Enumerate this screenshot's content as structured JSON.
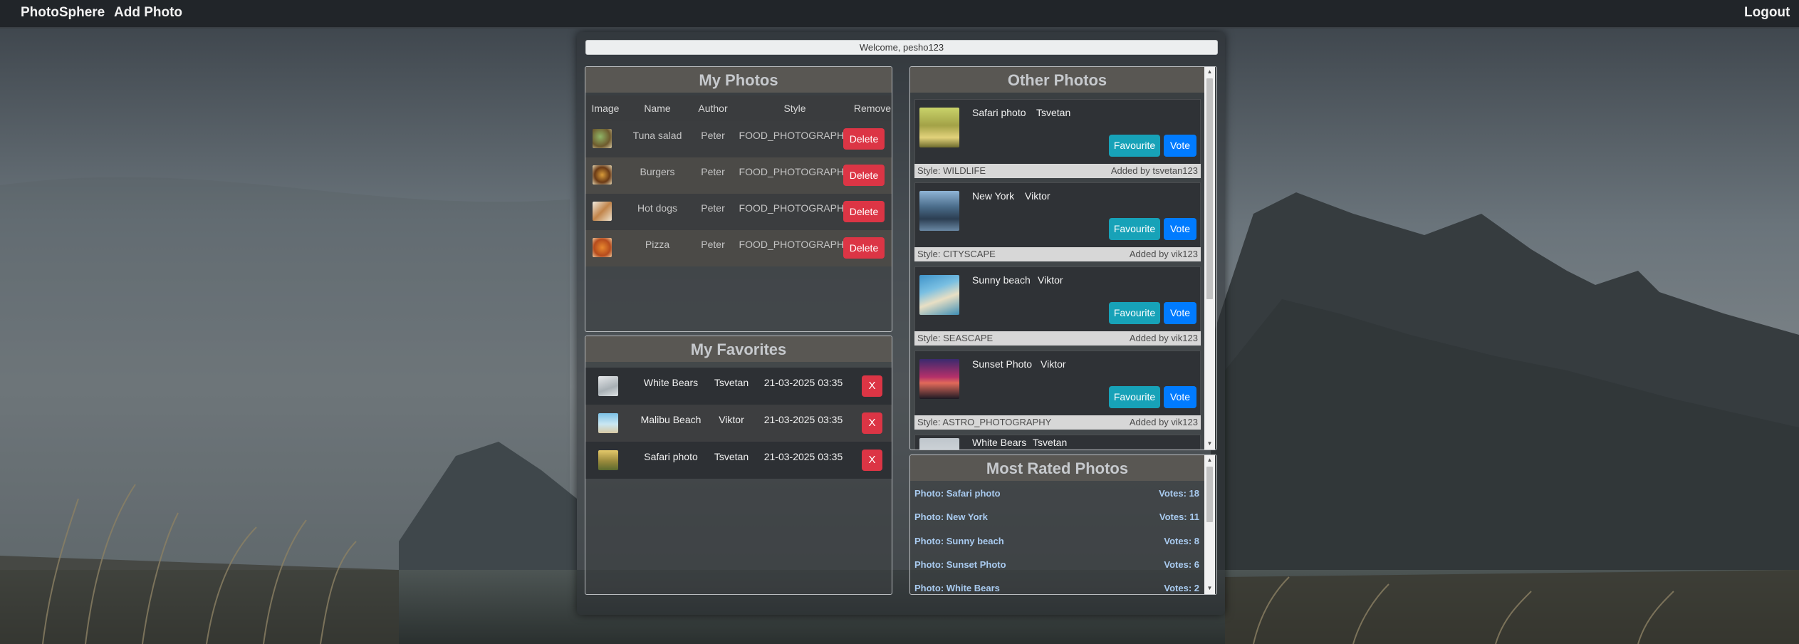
{
  "nav": {
    "brand": "PhotoSphere",
    "add_photo": "Add Photo",
    "logout": "Logout"
  },
  "welcome": "Welcome, pesho123",
  "my_photos": {
    "title": "My Photos",
    "columns": [
      "Image",
      "Name",
      "Author",
      "Style",
      "Remove"
    ],
    "rows": [
      {
        "name": "Tuna salad",
        "author": "Peter",
        "style": "FOOD_PHOTOGRAPHY",
        "action": "Delete"
      },
      {
        "name": "Burgers",
        "author": "Peter",
        "style": "FOOD_PHOTOGRAPHY",
        "action": "Delete"
      },
      {
        "name": "Hot dogs",
        "author": "Peter",
        "style": "FOOD_PHOTOGRAPHY",
        "action": "Delete"
      },
      {
        "name": "Pizza",
        "author": "Peter",
        "style": "FOOD_PHOTOGRAPHY",
        "action": "Delete"
      }
    ]
  },
  "my_favorites": {
    "title": "My Favorites",
    "rows": [
      {
        "name": "White Bears",
        "author": "Tsvetan",
        "date": "21-03-2025 03:35",
        "action": "X"
      },
      {
        "name": "Malibu Beach",
        "author": "Viktor",
        "date": "21-03-2025 03:35",
        "action": "X"
      },
      {
        "name": "Safari photo",
        "author": "Tsvetan",
        "date": "21-03-2025 03:35",
        "action": "X"
      }
    ]
  },
  "other_photos": {
    "title": "Other Photos",
    "favourite_label": "Favourite",
    "vote_label": "Vote",
    "cards": [
      {
        "name": "Safari photo",
        "author": "Tsvetan",
        "style": "Style: WILDLIFE",
        "added": "Added by tsvetan123"
      },
      {
        "name": "New York",
        "author": "Viktor",
        "style": "Style: CITYSCAPE",
        "added": "Added by vik123"
      },
      {
        "name": "Sunny beach",
        "author": "Viktor",
        "style": "Style: SEASCAPE",
        "added": "Added by vik123"
      },
      {
        "name": "Sunset Photo",
        "author": "Viktor",
        "style": "Style: ASTRO_PHOTOGRAPHY",
        "added": "Added by vik123"
      },
      {
        "name": "White Bears",
        "author": "Tsvetan"
      }
    ]
  },
  "most_rated": {
    "title": "Most Rated Photos",
    "rows": [
      {
        "photo": "Photo: Safari photo",
        "votes": "Votes: 18"
      },
      {
        "photo": "Photo: New York",
        "votes": "Votes: 11"
      },
      {
        "photo": "Photo: Sunny beach",
        "votes": "Votes: 8"
      },
      {
        "photo": "Photo: Sunset Photo",
        "votes": "Votes: 6"
      },
      {
        "photo": "Photo: White Bears",
        "votes": "Votes: 2"
      }
    ]
  },
  "colors": {
    "danger": "#dc3545",
    "info": "#17a2b8",
    "primary": "#007bff",
    "navbar": "#212529"
  }
}
